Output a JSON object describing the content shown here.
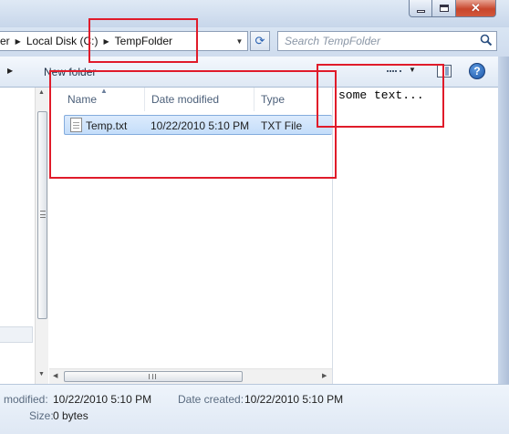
{
  "window": {
    "close_glyph": "✕"
  },
  "address_bar": {
    "breadcrumbs": [
      "er",
      "Local Disk (C:)",
      "TempFolder"
    ],
    "separator": "▶",
    "dropdown_glyph": "▼",
    "refresh_glyph": "⟳"
  },
  "search": {
    "placeholder": "Search TempFolder",
    "icon": "search-icon"
  },
  "toolbar": {
    "left_arrow": "▶",
    "new_folder_label": "New folder",
    "views_arrow": "▼",
    "help_label": "?"
  },
  "file_list": {
    "columns": [
      {
        "label": "Name",
        "sorted": "ascending"
      },
      {
        "label": "Date modified"
      },
      {
        "label": "Type"
      }
    ],
    "sort_glyph": "▲",
    "rows": [
      {
        "name": "Temp.txt",
        "date_modified": "10/22/2010 5:10 PM",
        "type": "TXT File",
        "selected": true
      }
    ]
  },
  "scrollbars": {
    "up": "▲",
    "down": "▼",
    "left": "◀",
    "right": "▶"
  },
  "preview": {
    "text": "some text..."
  },
  "details": {
    "modified_label": "modified:",
    "modified_value": "10/22/2010 5:10 PM",
    "created_label": "Date created:",
    "created_value": "10/22/2010 5:10 PM",
    "size_label": "Size:",
    "size_value": "0 bytes"
  },
  "colors": {
    "annotation": "#e01b2a",
    "selection": "#c4ddfa",
    "chrome": "#dee8f4"
  }
}
